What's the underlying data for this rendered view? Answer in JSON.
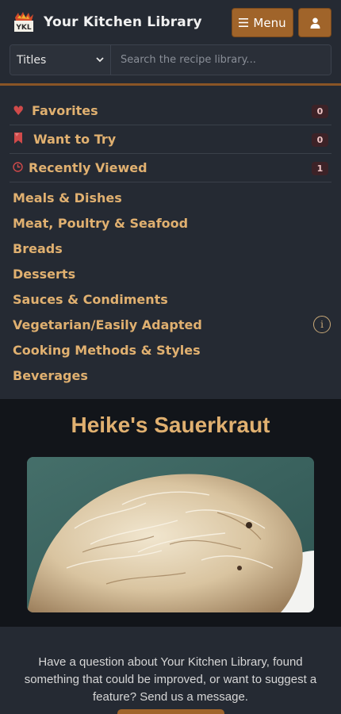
{
  "header": {
    "title": "Your Kitchen Library",
    "logo_text": "YKL",
    "menu_label": "Menu",
    "menu_icon": "hamburger-icon",
    "user_icon": "person-icon",
    "accent_color": "#a0642a"
  },
  "search": {
    "scope_selected": "Titles",
    "placeholder": "Search the recipe library..."
  },
  "quick_links": [
    {
      "label": "Favorites",
      "icon": "heart-icon",
      "count": "0"
    },
    {
      "label": "Want to Try",
      "icon": "bookmark-icon",
      "count": "0"
    },
    {
      "label": "Recently Viewed",
      "icon": "clock-icon",
      "count": "1"
    }
  ],
  "categories": [
    "Meals & Dishes",
    "Meat, Poultry & Seafood",
    "Breads",
    "Desserts",
    "Sauces & Condiments",
    "Vegetarian/Easily Adapted",
    "Cooking Methods & Styles",
    "Beverages"
  ],
  "featured": {
    "title": "Heike's Sauerkraut"
  },
  "footer": {
    "message": "Have a question about Your Kitchen Library, found something that could be improved, or want to suggest a feature? Send us a message."
  }
}
